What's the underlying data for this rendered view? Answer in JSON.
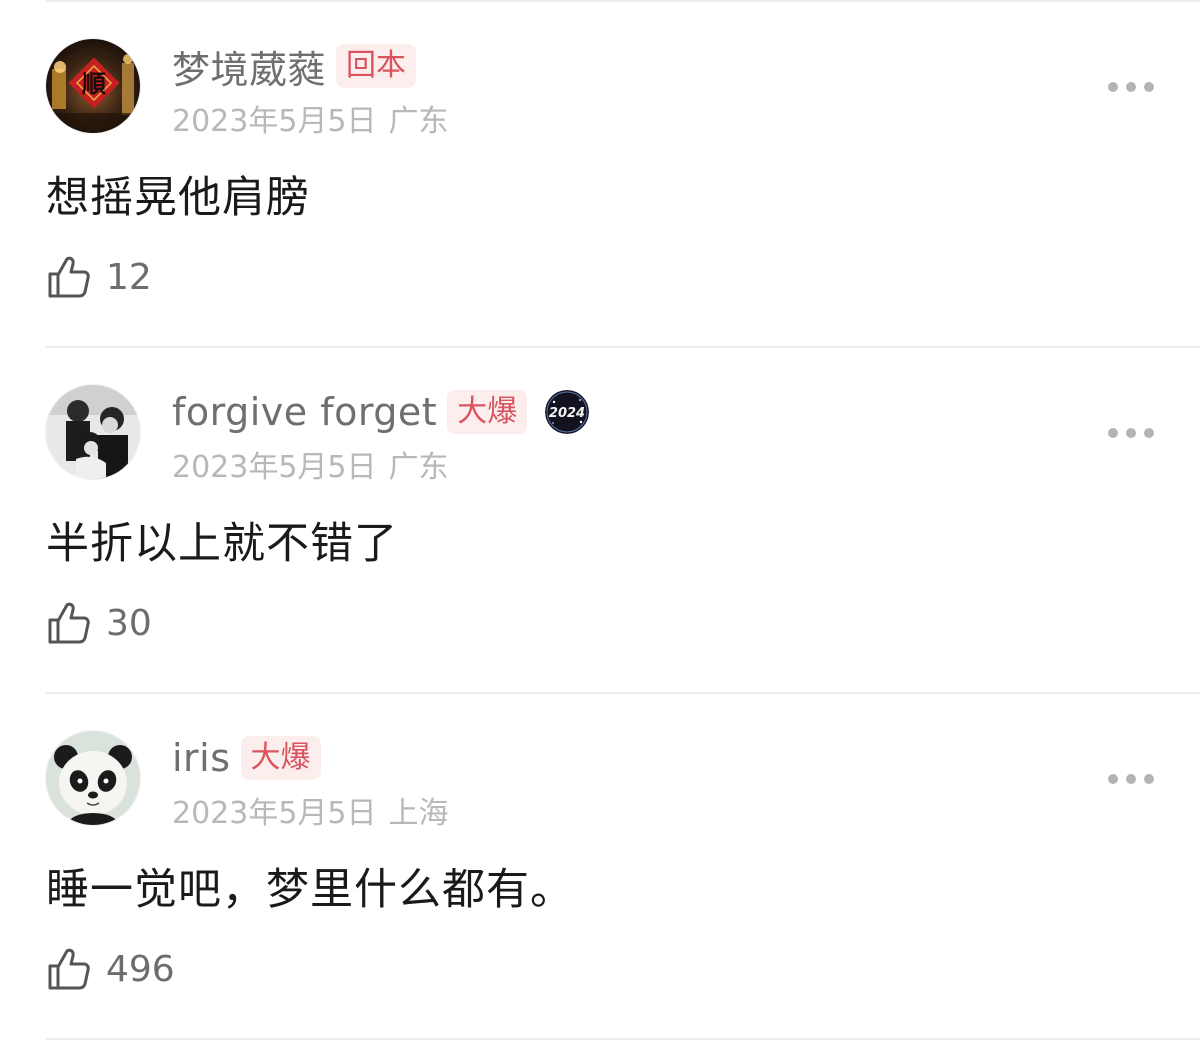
{
  "comments": [
    {
      "username": "梦境葳蕤",
      "tag": "回本",
      "date": "2023年5月5日",
      "location": "广东",
      "content": "想摇晃他肩膀",
      "likes": "12",
      "avatar_char": "順"
    },
    {
      "username": "forgive forget",
      "tag": "大爆",
      "date": "2023年5月5日",
      "location": "广东",
      "content": "半折以上就不错了",
      "likes": "30",
      "badge_text": "2024"
    },
    {
      "username": "iris",
      "tag": "大爆",
      "date": "2023年5月5日",
      "location": "上海",
      "content": "睡一觉吧，梦里什么都有。",
      "likes": "496"
    }
  ],
  "icons": {
    "like": "thumbs-up-icon",
    "more": "more-horizontal-icon"
  },
  "colors": {
    "tag_bg": "#fdeeee",
    "tag_text": "#d9545e",
    "meta_text": "#b8b8b8",
    "username_text": "#6f6f6f"
  }
}
